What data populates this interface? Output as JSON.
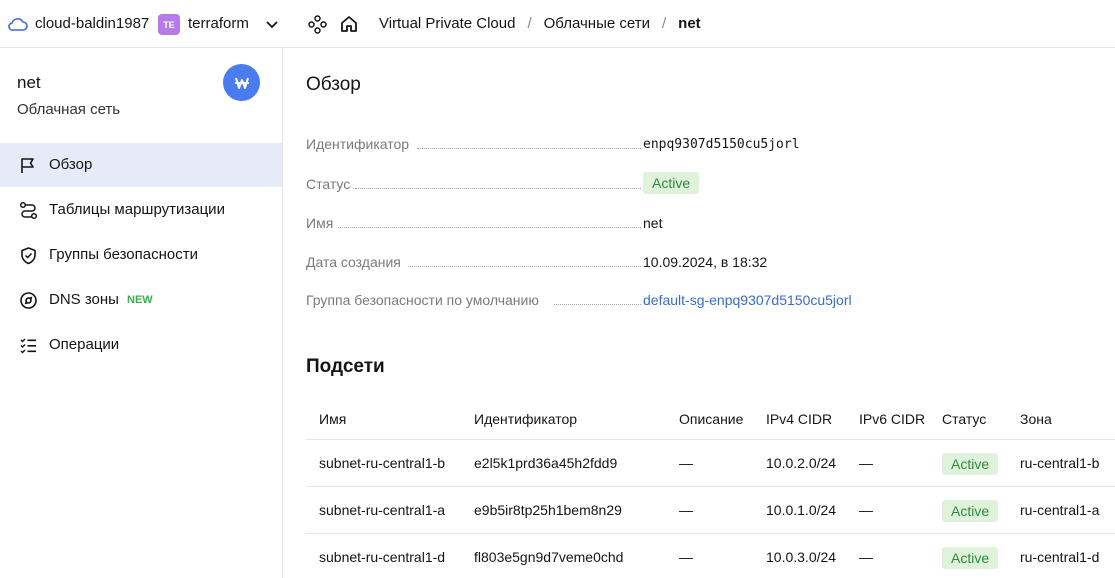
{
  "topbar": {
    "cloud_label": "cloud-baldin1987",
    "folder_badge": "TE",
    "folder_label": "terraform",
    "breadcrumbs": [
      "Virtual Private Cloud",
      "Облачные сети",
      "net"
    ],
    "folder_badge_color": "#b67be6"
  },
  "sidebar": {
    "title": "net",
    "subtitle": "Облачная сеть",
    "avatar_icon": "network-icon",
    "avatar_color": "#4a7cf0",
    "items": [
      {
        "label": "Обзор",
        "icon": "flag-icon",
        "active": true
      },
      {
        "label": "Таблицы маршрутизации",
        "icon": "route-icon"
      },
      {
        "label": "Группы безопасности",
        "icon": "shield-icon"
      },
      {
        "label": "DNS зоны",
        "icon": "compass-icon",
        "badge": "NEW"
      },
      {
        "label": "Операции",
        "icon": "list-check-icon"
      }
    ]
  },
  "overview": {
    "heading": "Обзор",
    "props": [
      {
        "label": "Идентификатор",
        "value": "enpq9307d5150cu5jorl"
      },
      {
        "label": "Статус",
        "value": "Active"
      },
      {
        "label": "Имя",
        "value": "net"
      },
      {
        "label": "Дата создания",
        "value": "10.09.2024, в 18:32"
      },
      {
        "label": "Группа безопасности по умолчанию",
        "value": "default-sg-enpq9307d5150cu5jorl"
      }
    ]
  },
  "subnets": {
    "heading": "Подсети",
    "columns": [
      "Имя",
      "Идентификатор",
      "Описание",
      "IPv4 CIDR",
      "IPv6 CIDR",
      "Статус",
      "Зона"
    ],
    "rows": [
      [
        "subnet-ru-central1-b",
        "e2l5k1prd36a45h2fdd9",
        "—",
        "10.0.2.0/24",
        "—",
        "Active",
        "ru-central1-b"
      ],
      [
        "subnet-ru-central1-a",
        "e9b5ir8tp25h1bem8n29",
        "—",
        "10.0.1.0/24",
        "—",
        "Active",
        "ru-central1-a"
      ],
      [
        "subnet-ru-central1-d",
        "fl803e5gn9d7veme0chd",
        "—",
        "10.0.3.0/24",
        "—",
        "Active",
        "ru-central1-d"
      ]
    ]
  },
  "colors": {
    "accent": "#4a7cf0",
    "active_bg": "#dff2da",
    "active_text": "#2d8a3a",
    "link": "#3a6ad4",
    "selected_nav": "#e6ebfa",
    "new_badge": "#3cac4e"
  }
}
